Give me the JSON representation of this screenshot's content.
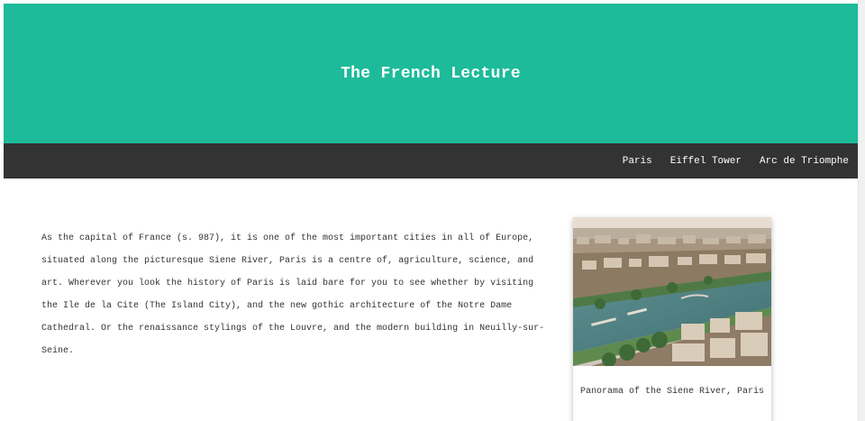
{
  "header": {
    "title": "The French Lecture"
  },
  "nav": {
    "links": [
      "Paris",
      "Eiffel Tower",
      "Arc de Triomphe"
    ]
  },
  "article": {
    "text": "As the capital of France (s. 987), it is one of the most important cities in all of Europe, situated along the picturesque Siene River, Paris is a centre of, agriculture, science, and art. Wherever you look the history of Paris is laid bare for you to see whether by visiting the Ile de la Cite (The Island City), and the new gothic architecture of the Notre Dame Cathedral. Or the renaissance stylings of the Louvre, and the modern building in Neuilly-sur-Seine."
  },
  "card": {
    "caption": "Panorama of the Siene River, Paris"
  },
  "colors": {
    "hero": "#1dbb9a",
    "navbar": "#333333",
    "text": "#333333"
  }
}
